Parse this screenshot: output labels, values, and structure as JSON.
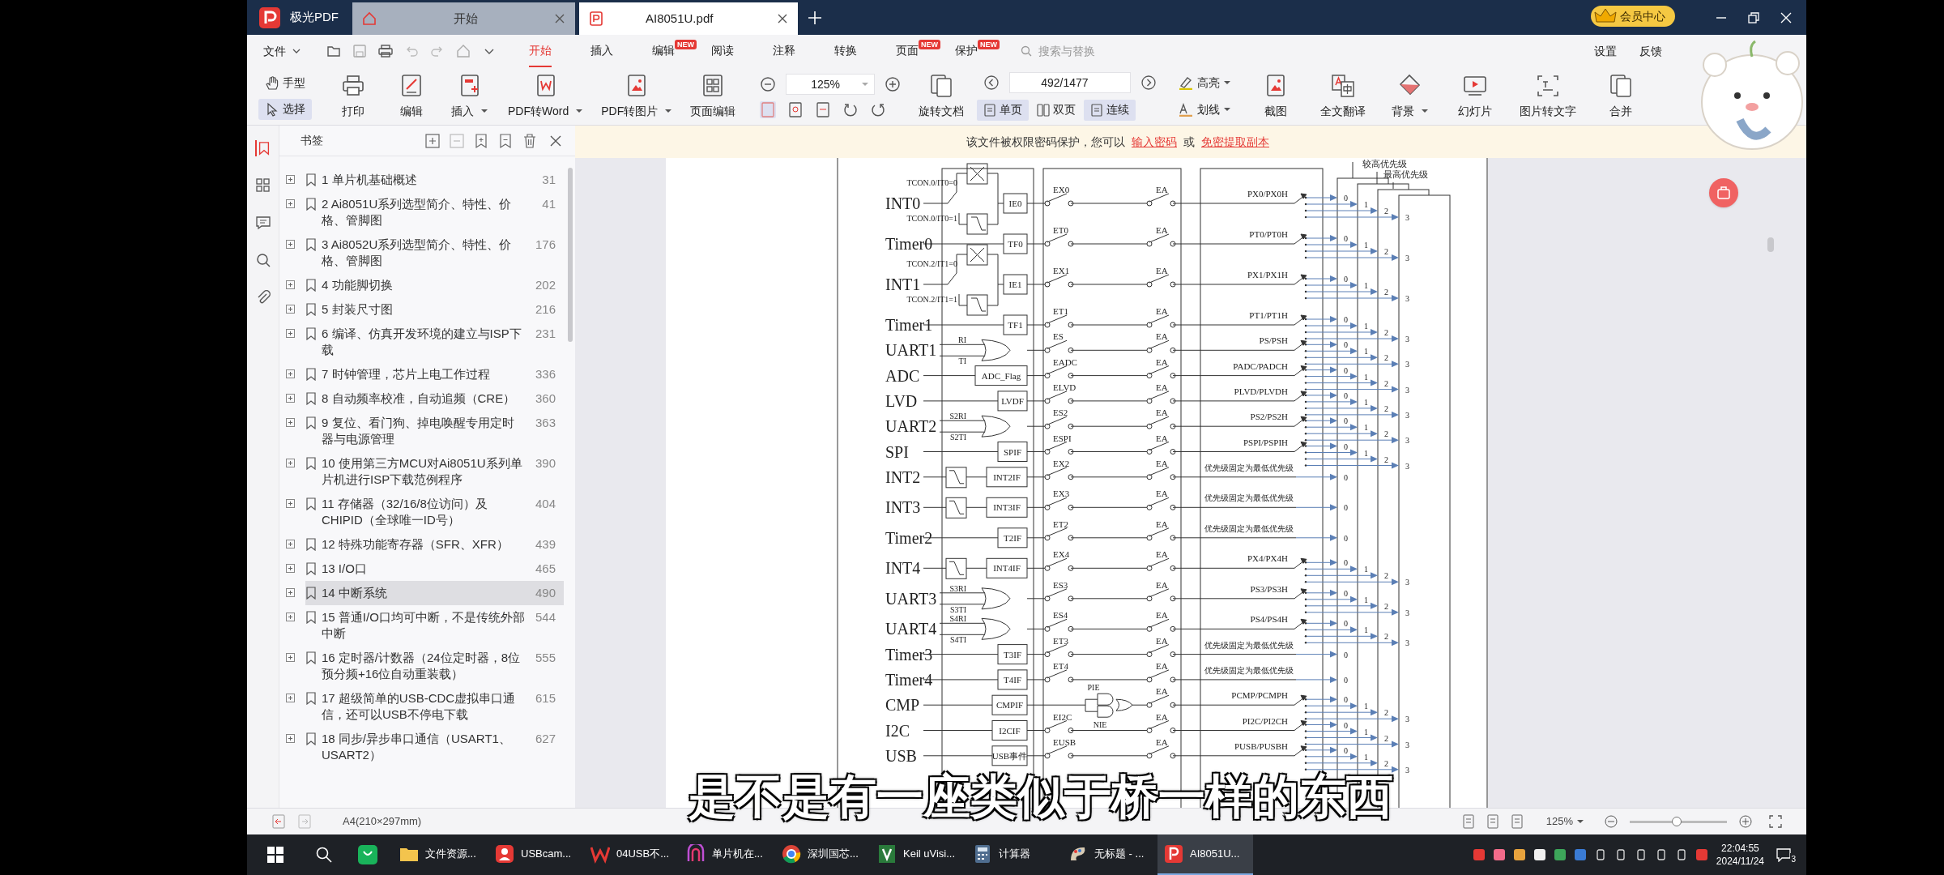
{
  "title_bar": {
    "app_name": "极光PDF",
    "tabs": [
      {
        "label": "开始",
        "kind": "home",
        "selected": false
      },
      {
        "label": "AI8051U.pdf",
        "kind": "pdf",
        "selected": true
      }
    ],
    "member": "会员中心"
  },
  "menu_bar": {
    "file": "文件",
    "tabs": [
      {
        "label": "开始",
        "selected": true
      },
      {
        "label": "插入",
        "selected": false
      },
      {
        "label": "编辑",
        "selected": false,
        "badge": "NEW"
      },
      {
        "label": "阅读",
        "selected": false
      },
      {
        "label": "注释",
        "selected": false
      },
      {
        "label": "转换",
        "selected": false
      },
      {
        "label": "页面",
        "selected": false,
        "badge": "NEW"
      },
      {
        "label": "保护",
        "selected": false,
        "badge": "NEW"
      }
    ],
    "search": {
      "placeholder": "搜索与替换"
    },
    "links": [
      "设置",
      "反馈"
    ]
  },
  "toolbar": {
    "pointer_tools": [
      {
        "label": "手型",
        "kind": "hand",
        "selected": false
      },
      {
        "label": "选择",
        "kind": "select",
        "selected": true
      }
    ],
    "buttons": [
      {
        "label": "打印",
        "kind": "print",
        "dropdown": false
      },
      {
        "label": "编辑",
        "kind": "edit",
        "dropdown": false
      },
      {
        "label": "插入",
        "kind": "insert",
        "dropdown": true
      },
      {
        "label": "PDF转Word",
        "kind": "word",
        "dropdown": true
      },
      {
        "label": "PDF转图片",
        "kind": "image",
        "dropdown": true
      },
      {
        "label": "页面编辑",
        "kind": "pages",
        "dropdown": false
      }
    ],
    "zoom": "125%",
    "rotate": "旋转文档",
    "page": "492/1477",
    "view_modes": [
      {
        "label": "单页",
        "selected": true
      },
      {
        "label": "双页",
        "selected": false
      },
      {
        "label": "连续",
        "selected": true
      }
    ],
    "markup": [
      {
        "label": "高亮",
        "kind": "highlight"
      },
      {
        "label": "划线",
        "kind": "strike"
      }
    ],
    "tools": [
      {
        "label": "截图",
        "kind": "image",
        "dropdown": false
      },
      {
        "label": "全文翻译",
        "kind": "translate",
        "dropdown": false
      },
      {
        "label": "背景",
        "kind": "background",
        "dropdown": true
      },
      {
        "label": "幻灯片",
        "kind": "slides",
        "dropdown": false
      },
      {
        "label": "图片转文字",
        "kind": "ocr",
        "dropdown": false
      },
      {
        "label": "合并",
        "kind": "merge",
        "dropdown": false
      }
    ]
  },
  "bookmarks": {
    "title": "书签",
    "items": [
      {
        "title": "1 单片机基础概述",
        "page": "31",
        "selected": false
      },
      {
        "title": "2 Ai8051U系列选型简介、特性、价格、管脚图",
        "page": "41",
        "selected": false
      },
      {
        "title": "3 Ai8052U系列选型简介、特性、价格、管脚图",
        "page": "176",
        "selected": false
      },
      {
        "title": "4 功能脚切换",
        "page": "202",
        "selected": false
      },
      {
        "title": "5 封装尺寸图",
        "page": "216",
        "selected": false
      },
      {
        "title": "6 编译、仿真开发环境的建立与ISP下载",
        "page": "231",
        "selected": false
      },
      {
        "title": "7 时钟管理，芯片上电工作过程",
        "page": "336",
        "selected": false
      },
      {
        "title": "8 自动频率校准，自动追频（CRE）",
        "page": "360",
        "selected": false
      },
      {
        "title": "9 复位、看门狗、掉电唤醒专用定时器与电源管理",
        "page": "363",
        "selected": false
      },
      {
        "title": "10 使用第三方MCU对Ai8051U系列单片机进行ISP下载范例程序",
        "page": "390",
        "selected": false
      },
      {
        "title": "11 存储器（32/16/8位访问）及CHIPID（全球唯一ID号）",
        "page": "404",
        "selected": false
      },
      {
        "title": "12 特殊功能寄存器（SFR、XFR）",
        "page": "439",
        "selected": false
      },
      {
        "title": "13 I/O口",
        "page": "465",
        "selected": false
      },
      {
        "title": "14 中断系统",
        "page": "490",
        "selected": true
      },
      {
        "title": "15 普通I/O口均可中断，不是传统外部中断",
        "page": "544",
        "selected": false
      },
      {
        "title": "16 定时器/计数器（24位定时器，8位预分频+16位自动重装载）",
        "page": "555",
        "selected": false
      },
      {
        "title": "17 超级简单的USB-CDC虚拟串口通信，还可以USB不停电下载",
        "page": "615",
        "selected": false
      },
      {
        "title": "18 同步/异步串口通信（USART1、USART2）",
        "page": "627",
        "selected": false
      }
    ]
  },
  "notice": {
    "text": "该文件被权限密码保护，您可以",
    "link_1": "输入密码",
    "joiner": "或",
    "link_2": "免密提取副本"
  },
  "diagram": {
    "top_labels": [
      "较高优先级",
      "最高优先级"
    ],
    "rows": [
      {
        "source": "INT0",
        "kind": "edge",
        "inputs": [
          "TCON.0/IT0=0",
          "TCON.0/IT0=1"
        ],
        "flag": "IE0",
        "enable": "EX0",
        "gate": "EA",
        "priority": "PX0/PX0H",
        "fixed": false,
        "levels": [
          "0",
          "1",
          "2",
          "3"
        ]
      },
      {
        "source": "Timer0",
        "kind": "flag",
        "flag": "TF0",
        "enable": "ET0",
        "gate": "EA",
        "priority": "PT0/PT0H",
        "fixed": false,
        "levels": [
          "0",
          "1",
          "2",
          "3"
        ]
      },
      {
        "source": "INT1",
        "kind": "edge",
        "inputs": [
          "TCON.2/IT1=0",
          "TCON.2/IT1=1"
        ],
        "flag": "IE1",
        "enable": "EX1",
        "gate": "EA",
        "priority": "PX1/PX1H",
        "fixed": false,
        "levels": [
          "0",
          "1",
          "2",
          "3"
        ]
      },
      {
        "source": "Timer1",
        "kind": "flag",
        "flag": "TF1",
        "enable": "ET1",
        "gate": "EA",
        "priority": "PT1/PT1H",
        "fixed": false,
        "levels": [
          "0",
          "1",
          "2",
          "3"
        ]
      },
      {
        "source": "UART1",
        "kind": "or",
        "inputs": [
          "RI",
          "TI"
        ],
        "enable": "ES",
        "gate": "EA",
        "priority": "PS/PSH",
        "fixed": false,
        "levels": [
          "0",
          "1",
          "2",
          "3"
        ]
      },
      {
        "source": "ADC",
        "kind": "flag",
        "flag": "ADC_Flag",
        "enable": "EADC",
        "gate": "EA",
        "priority": "PADC/PADCH",
        "fixed": false,
        "levels": [
          "0",
          "1",
          "2",
          "3"
        ]
      },
      {
        "source": "LVD",
        "kind": "flag",
        "flag": "LVDF",
        "enable": "ELVD",
        "gate": "EA",
        "priority": "PLVD/PLVDH",
        "fixed": false,
        "levels": [
          "0",
          "1",
          "2",
          "3"
        ]
      },
      {
        "source": "UART2",
        "kind": "or",
        "inputs": [
          "S2RI",
          "S2TI"
        ],
        "enable": "ES2",
        "gate": "EA",
        "priority": "PS2/PS2H",
        "fixed": false,
        "levels": [
          "0",
          "1",
          "2",
          "3"
        ]
      },
      {
        "source": "SPI",
        "kind": "flag",
        "flag": "SPIF",
        "enable": "ESPI",
        "gate": "EA",
        "priority": "PSPI/PSPIH",
        "fixed": false,
        "levels": [
          "0",
          "1",
          "2",
          "3"
        ]
      },
      {
        "source": "INT2",
        "kind": "falling",
        "flag": "INT2IF",
        "enable": "EX2",
        "gate": "EA",
        "priority": "优先级固定为最低优先级",
        "fixed": true,
        "levels": [
          "0"
        ]
      },
      {
        "source": "INT3",
        "kind": "falling",
        "flag": "INT3IF",
        "enable": "EX3",
        "gate": "EA",
        "priority": "优先级固定为最低优先级",
        "fixed": true,
        "levels": [
          "0"
        ]
      },
      {
        "source": "Timer2",
        "kind": "flag",
        "flag": "T2IF",
        "enable": "ET2",
        "gate": "EA",
        "priority": "优先级固定为最低优先级",
        "fixed": true,
        "levels": [
          "0"
        ]
      },
      {
        "source": "INT4",
        "kind": "falling",
        "flag": "INT4IF",
        "enable": "EX4",
        "gate": "EA",
        "priority": "PX4/PX4H",
        "fixed": false,
        "levels": [
          "0",
          "1",
          "2",
          "3"
        ]
      },
      {
        "source": "UART3",
        "kind": "or",
        "inputs": [
          "S3RI",
          "S3TI"
        ],
        "enable": "ES3",
        "gate": "EA",
        "priority": "PS3/PS3H",
        "fixed": false,
        "levels": [
          "0",
          "1",
          "2",
          "3"
        ]
      },
      {
        "source": "UART4",
        "kind": "or",
        "inputs": [
          "S4RI",
          "S4TI"
        ],
        "enable": "ES4",
        "gate": "EA",
        "priority": "PS4/PS4H",
        "fixed": false,
        "levels": [
          "0",
          "1",
          "2",
          "3"
        ]
      },
      {
        "source": "Timer3",
        "kind": "flag",
        "flag": "T3IF",
        "enable": "ET3",
        "gate": "EA",
        "priority": "优先级固定为最低优先级",
        "fixed": true,
        "levels": [
          "0"
        ]
      },
      {
        "source": "Timer4",
        "kind": "flag",
        "flag": "T4IF",
        "enable": "ET4",
        "gate": "EA",
        "priority": "优先级固定为最低优先级",
        "fixed": true,
        "levels": [
          "0"
        ]
      },
      {
        "source": "CMP",
        "kind": "gated",
        "flag": "CMPIF",
        "inputs": [
          "PIE",
          "NIE"
        ],
        "gate": "EA",
        "priority": "PCMP/PCMPH",
        "fixed": false,
        "levels": [
          "0",
          "1",
          "2",
          "3"
        ]
      },
      {
        "source": "I2C",
        "kind": "flag",
        "flag": "I2CIF",
        "enable": "EI2C",
        "gate": "EA",
        "priority": "PI2C/PI2CH",
        "fixed": false,
        "levels": [
          "0",
          "1",
          "2",
          "3"
        ]
      },
      {
        "source": "USB",
        "kind": "flag",
        "flag": "USB事件",
        "enable": "EUSB",
        "gate": "EA",
        "priority": "PUSB/PUSBH",
        "fixed": false,
        "levels": [
          "0",
          "1",
          "2",
          "3"
        ]
      }
    ]
  },
  "subtitle": "是不是有一座类似于桥一样的东西",
  "status_bar": {
    "paper": "A4(210×297mm)",
    "zoom": "125%",
    "zoom_slider": {
      "level": 0.48
    }
  },
  "taskbar": {
    "apps": [
      {
        "label": "文件资源...",
        "kind": "folder",
        "active": false
      },
      {
        "label": "USBcam...",
        "kind": "cam",
        "active": false
      },
      {
        "label": "04USB不...",
        "kind": "w",
        "active": false
      },
      {
        "label": "单片机在...",
        "kind": "stream",
        "active": false
      },
      {
        "label": "深圳国芯...",
        "kind": "chrome",
        "active": false
      },
      {
        "label": "Keil uVisi...",
        "kind": "keil",
        "active": false
      },
      {
        "label": "计算器",
        "kind": "calc",
        "active": false
      },
      {
        "label": "无标题 - ...",
        "kind": "paint",
        "active": false
      },
      {
        "label": "AI8051U...",
        "kind": "pdf",
        "active": true
      }
    ],
    "time": "22:04:55",
    "date": "2024/11/24",
    "notifications": "3"
  }
}
